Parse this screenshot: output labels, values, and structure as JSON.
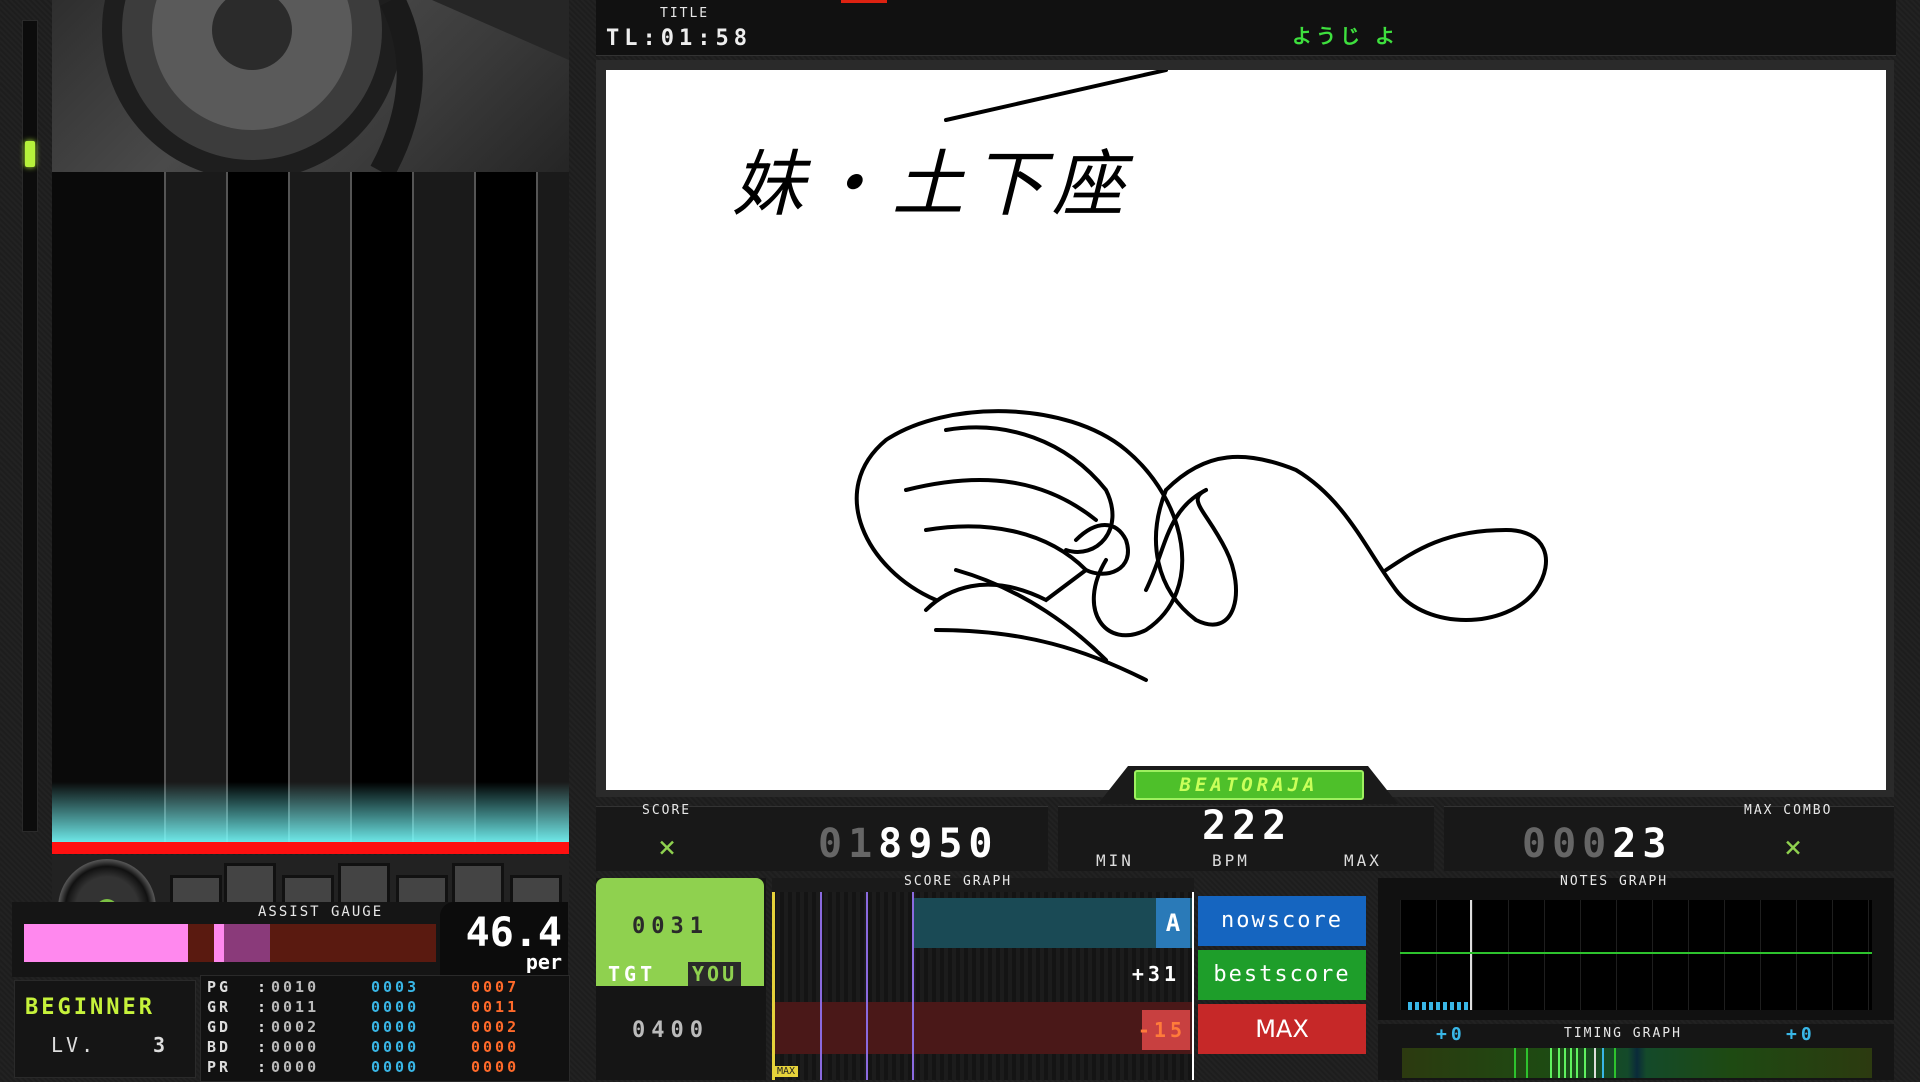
{
  "header": {
    "title_label": "TITLE",
    "time_left": "TL:01:58",
    "song_title": "ようじ よ"
  },
  "brand": "BEATORAJA",
  "score_panel": {
    "label": "SCORE",
    "value_dim": "01",
    "value": "8950"
  },
  "bpm_panel": {
    "value": "222",
    "min_label": "MIN",
    "bpm_label": "BPM",
    "max_label": "MAX"
  },
  "combo_panel": {
    "label": "MAX COMBO",
    "value_dim": "000",
    "value": "23"
  },
  "assist": {
    "label": "ASSIST GAUGE",
    "value": "46.4",
    "unit": "per",
    "gauge_percent": 46.4
  },
  "difficulty": {
    "name": "BEGINNER",
    "level_label": "LV.",
    "level": "3"
  },
  "judges": {
    "labels": [
      "PG",
      "GR",
      "GD",
      "BD",
      "PR"
    ],
    "current": [
      "0010",
      "0011",
      "0002",
      "0000",
      "0000"
    ],
    "blue": [
      "0003",
      "0000",
      "0000",
      "0000",
      "0000"
    ],
    "red": [
      "0007",
      "0011",
      "0002",
      "0000",
      "0000"
    ]
  },
  "target_panel": {
    "value": "0031",
    "tgt_label": "TGT",
    "you_label": "YOU",
    "target_score": "0400"
  },
  "score_graph": {
    "label": "SCORE GRAPH",
    "grade": "A",
    "diff_best": "+31",
    "diff_max": "-15",
    "max_tag": "MAX"
  },
  "buttons": {
    "now": "nowscore",
    "best": "bestscore",
    "max": "MAX"
  },
  "notes_graph": {
    "label": "NOTES GRAPH"
  },
  "timing": {
    "label": "TIMING GRAPH",
    "left": "+0",
    "right": "+0"
  },
  "drawing": {
    "caption": "妹・土下座"
  },
  "colors": {
    "accent_green": "#8fd14f",
    "gauge_pink": "#ff88ee",
    "blue_btn": "#1565c0",
    "green_btn": "#1e9e2a",
    "red_btn": "#c62828"
  }
}
